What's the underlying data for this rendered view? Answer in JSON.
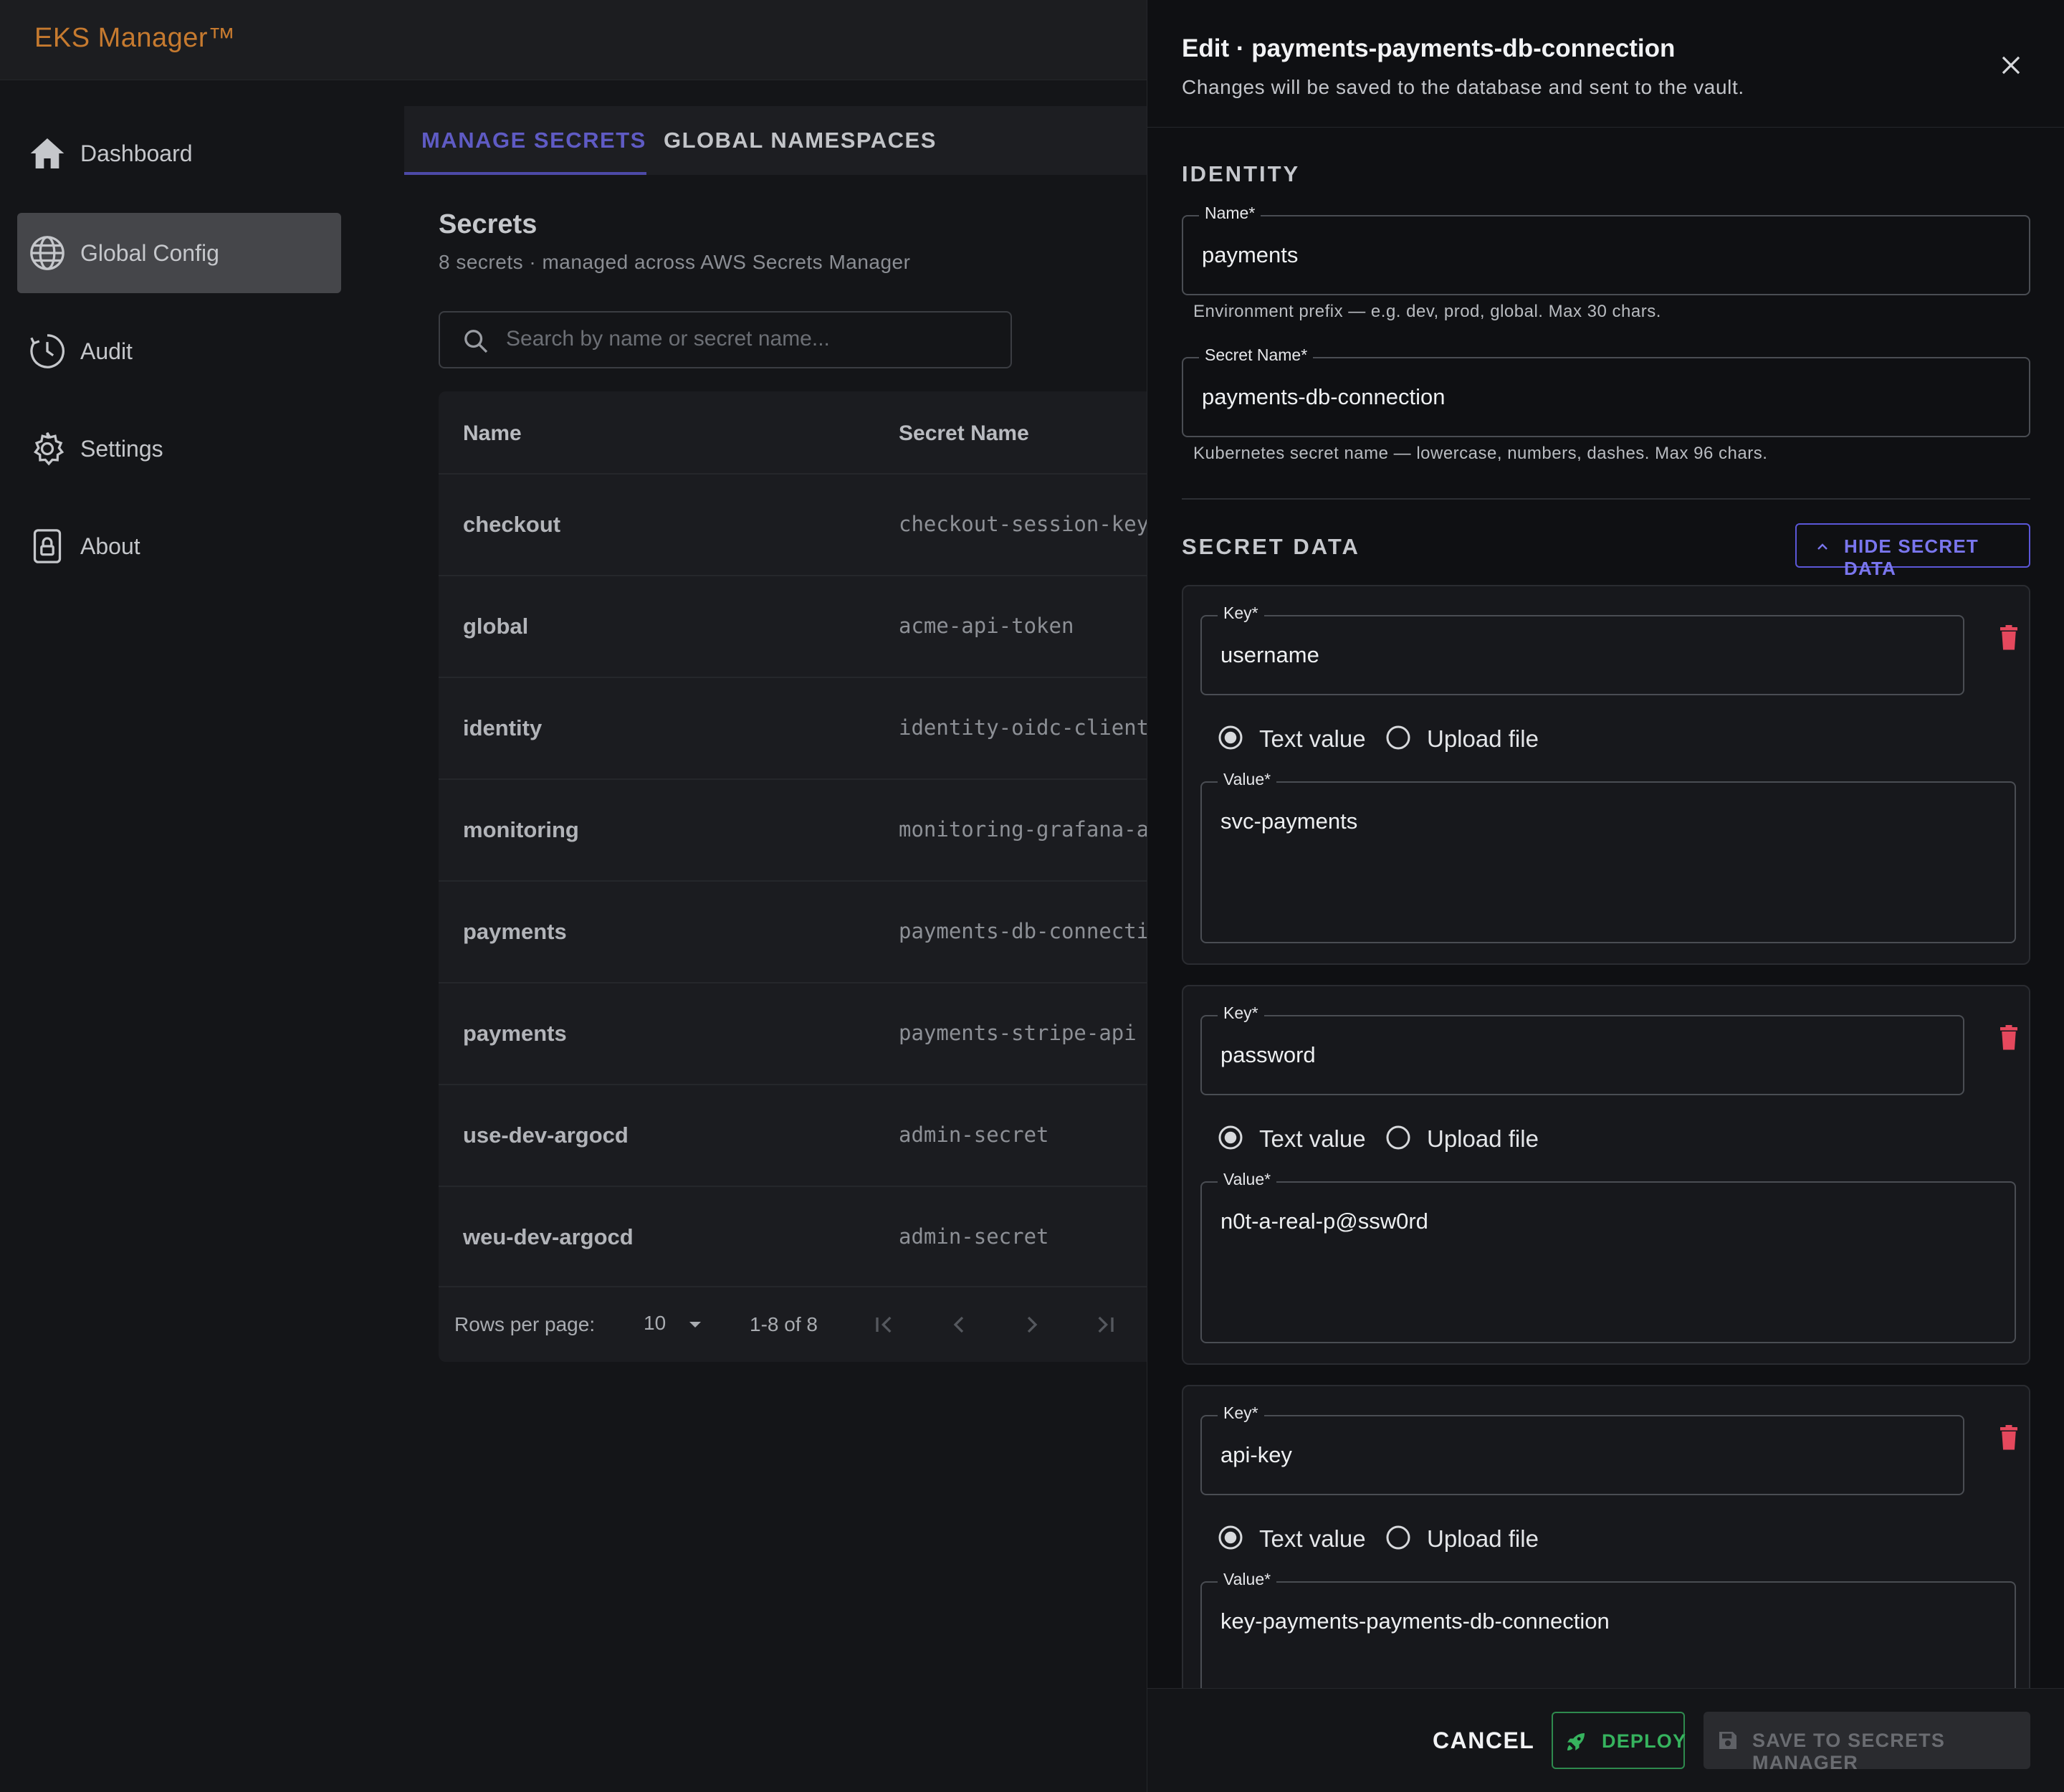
{
  "app": {
    "brand": "EKS Manager™"
  },
  "sidebar": {
    "items": [
      {
        "label": "Dashboard",
        "icon": "home-icon",
        "active": false
      },
      {
        "label": "Global Config",
        "icon": "globe-icon",
        "active": true
      },
      {
        "label": "Audit",
        "icon": "clock-icon",
        "active": false
      },
      {
        "label": "Settings",
        "icon": "gear-icon",
        "active": false
      },
      {
        "label": "About",
        "icon": "lock-icon",
        "active": false
      }
    ]
  },
  "tabs": [
    {
      "label": "MANAGE SECRETS",
      "active": true
    },
    {
      "label": "GLOBAL NAMESPACES",
      "active": false
    }
  ],
  "secrets": {
    "title": "Secrets",
    "subtitle": "8 secrets · managed across AWS Secrets Manager",
    "search_placeholder": "Search by name or secret name...",
    "columns": [
      "Name",
      "Secret Name"
    ],
    "rows": [
      {
        "name": "checkout",
        "secret": "checkout-session-key"
      },
      {
        "name": "global",
        "secret": "acme-api-token"
      },
      {
        "name": "identity",
        "secret": "identity-oidc-client"
      },
      {
        "name": "monitoring",
        "secret": "monitoring-grafana-admin"
      },
      {
        "name": "payments",
        "secret": "payments-db-connection"
      },
      {
        "name": "payments",
        "secret": "payments-stripe-api"
      },
      {
        "name": "use-dev-argocd",
        "secret": "admin-secret"
      },
      {
        "name": "weu-dev-argocd",
        "secret": "admin-secret"
      }
    ],
    "pagination": {
      "rows_per_page_label": "Rows per page:",
      "rows_per_page": "10",
      "range": "1-8 of 8"
    }
  },
  "drawer": {
    "title": "Edit · payments-payments-db-connection",
    "subtitle": "Changes will be saved to the database and sent to the vault.",
    "identity": {
      "section_title": "IDENTITY",
      "name": {
        "label": "Name*",
        "value": "payments",
        "helper": "Environment prefix — e.g. dev, prod, global. Max 30 chars."
      },
      "secret_name": {
        "label": "Secret Name*",
        "value": "payments-db-connection",
        "helper": "Kubernetes secret name — lowercase, numbers, dashes. Max 96 chars."
      }
    },
    "secret_data": {
      "section_title": "SECRET DATA",
      "toggle_label": "HIDE SECRET DATA",
      "key_label": "Key*",
      "value_label": "Value*",
      "text_option": "Text value",
      "file_option": "Upload file",
      "entries": [
        {
          "key": "username",
          "value": "svc-payments",
          "mode": "text"
        },
        {
          "key": "password",
          "value": "n0t-a-real-p@ssw0rd",
          "mode": "text"
        },
        {
          "key": "api-key",
          "value": "key-payments-payments-db-connection",
          "mode": "text"
        }
      ]
    },
    "footer": {
      "cancel": "CANCEL",
      "deploy": "DEPLOY",
      "save": "SAVE TO SECRETS MANAGER"
    }
  },
  "colors": {
    "brand": "#c67a2f",
    "accent": "#5b57d8",
    "deploy": "#36b35e",
    "danger": "#e5485d"
  }
}
